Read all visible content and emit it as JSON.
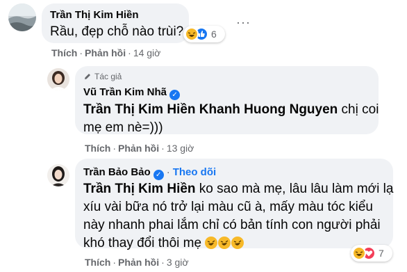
{
  "comments": [
    {
      "author": "Trần Thị Kim Hiền",
      "text": "Rầu, đẹp chỗ nào trùi?",
      "reaction_count": "6",
      "actions": {
        "like": "Thích",
        "reply": "Phản hồi",
        "time": "14 giờ"
      }
    },
    {
      "author_tag": "Tác giả",
      "author": "Vũ Trần Kim Nhã",
      "mention": "Trần Thị Kim Hiền Khanh Huong Nguyen",
      "text_line1_rest": " chị coi",
      "text_line2": "mẹ em nè=)))",
      "actions": {
        "like": "Thích",
        "reply": "Phản hồi",
        "time": "13 giờ"
      }
    },
    {
      "author": "Trần Bảo Bảo",
      "follow": "Theo dõi",
      "mention": "Trần Thị Kim Hiền",
      "text_line1_rest": " ko sao mà mẹ, lâu lâu làm mới lạ",
      "text_line2": "xíu vài bữa nó trở lại màu cũ à, mấy màu tóc kiểu",
      "text_line3": "này nhanh phai lắm chỉ có bản tính con người phải",
      "text_line4": "khó thay đổi thôi mẹ",
      "reaction_count": "7",
      "actions": {
        "like": "Thích",
        "reply": "Phản hồi",
        "time": "3 giờ"
      }
    }
  ],
  "icons": {
    "more": "more-options-icon",
    "verified": "verified-badge-icon",
    "author": "author-pen-icon",
    "haha": "haha-reaction-icon",
    "like": "like-reaction-icon",
    "love": "love-reaction-icon"
  },
  "colors": {
    "bubble": "#f0f2f5",
    "link": "#1877f2",
    "muted": "#65676b",
    "haha": "#f7b928",
    "love": "#f33e58"
  }
}
